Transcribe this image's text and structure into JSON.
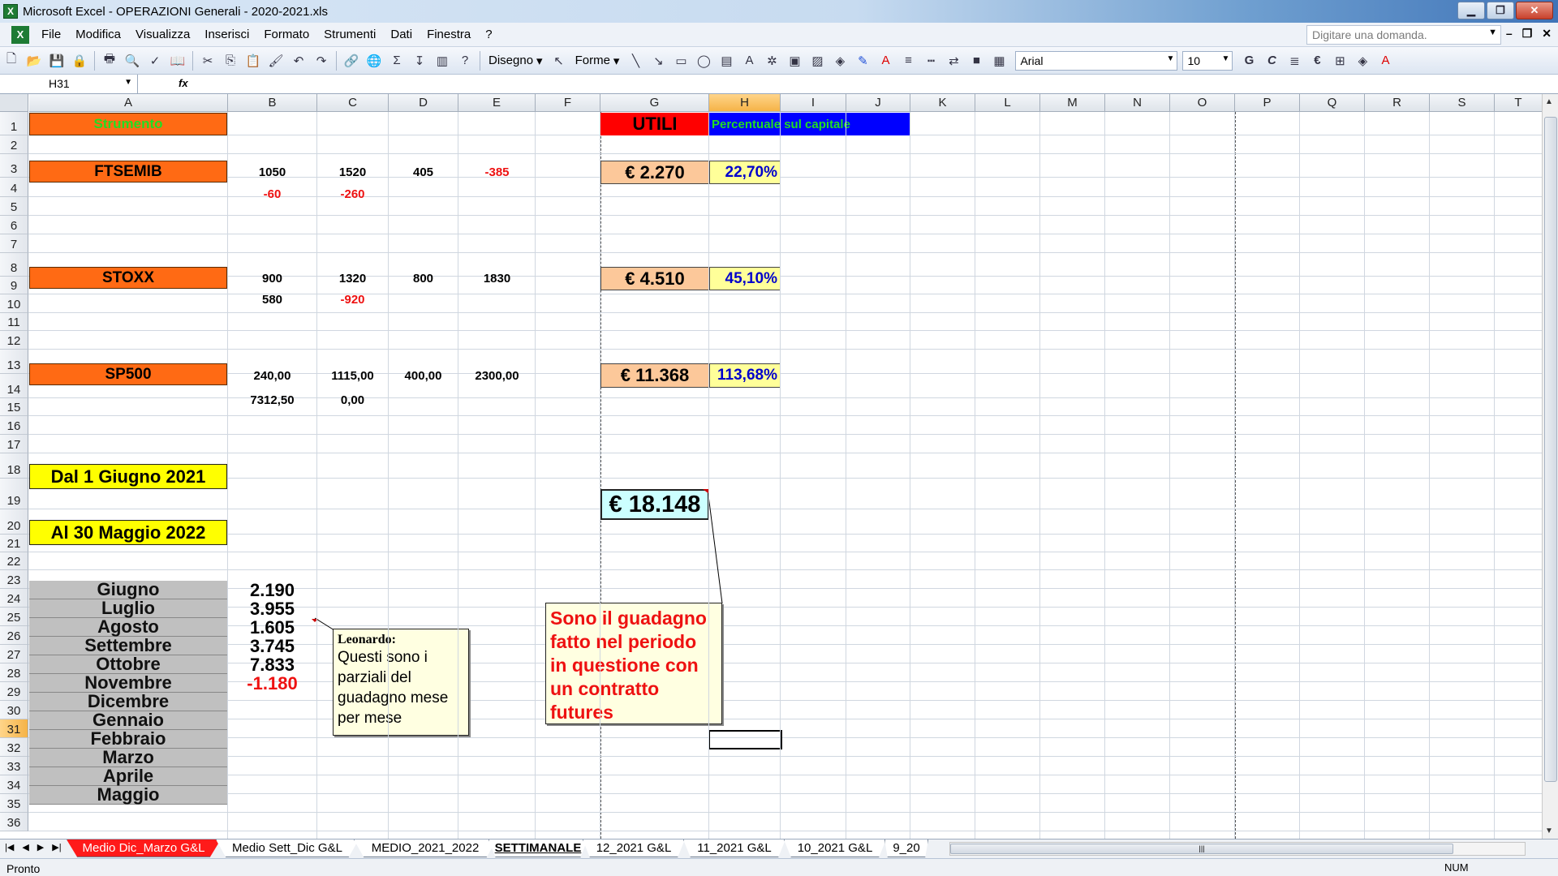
{
  "window": {
    "title": "Microsoft Excel - OPERAZIONI Generali - 2020-2021.xls"
  },
  "menu": [
    "File",
    "Modifica",
    "Visualizza",
    "Inserisci",
    "Formato",
    "Strumenti",
    "Dati",
    "Finestra",
    "?"
  ],
  "help_placeholder": "Digitare una domanda.",
  "toolbar": {
    "draw_label": "Disegno",
    "shapes_label": "Forme",
    "font": "Arial",
    "size": "10",
    "bold": "G",
    "italic": "C",
    "euro": "€"
  },
  "formula": {
    "cell_ref": "H31",
    "fx": "fx"
  },
  "columns": [
    "A",
    "B",
    "C",
    "D",
    "E",
    "F",
    "G",
    "H",
    "I",
    "J",
    "K",
    "L",
    "M",
    "N",
    "O",
    "P",
    "Q",
    "R",
    "S",
    "T"
  ],
  "rows": [
    "1",
    "2",
    "3",
    "4",
    "5",
    "6",
    "7",
    "8",
    "9",
    "10",
    "11",
    "12",
    "13",
    "14",
    "15",
    "16",
    "17",
    "18",
    "19",
    "20",
    "21",
    "22",
    "23",
    "24",
    "25",
    "26",
    "27",
    "28",
    "29",
    "30",
    "31",
    "32",
    "33",
    "34",
    "35",
    "36"
  ],
  "cells": {
    "a1": "Strumento",
    "g1": "UTILI",
    "h1": "Percentuale sul capitale",
    "a3": "FTSEMIB",
    "b3": "1050",
    "c3": "1520",
    "d3": "405",
    "e3": "-385",
    "b4": "-60",
    "c4": "-260",
    "g3": "€ 2.270",
    "h3": "22,70%",
    "a8": "STOXX",
    "b8": "900",
    "c8": "1320",
    "d8": "800",
    "e8": "1830",
    "b9": "580",
    "c9": "-920",
    "g8": "€ 4.510",
    "h8": "45,10%",
    "a13": "SP500",
    "b13": "240,00",
    "c13": "1115,00",
    "d13": "400,00",
    "e13": "2300,00",
    "b14": "7312,50",
    "c14": "0,00",
    "g13": "€ 11.368",
    "h13": "113,68%",
    "a18": "Dal 1 Giugno  2021",
    "a20": "Al 30 Maggio 2022",
    "g19": "€ 18.148"
  },
  "months": [
    "Giugno",
    "Luglio",
    "Agosto",
    "Settembre",
    "Ottobre",
    "Novembre",
    "Dicembre",
    "Gennaio",
    "Febbraio",
    "Marzo",
    "Aprile",
    "Maggio"
  ],
  "month_values": [
    "2.190",
    "3.955",
    "1.605",
    "3.745",
    "7.833",
    "-1.180"
  ],
  "comments": {
    "leonardo_author": "Leonardo:",
    "leonardo_text": "Questi sono i parziali del guadagno mese per mese",
    "futures_text": "Sono il guadagno fatto nel periodo in questione con un contratto futures"
  },
  "tabs": [
    "Medio Dic_Marzo G&L",
    "Medio Sett_Dic G&L",
    "MEDIO_2021_2022",
    "SETTIMANALE",
    "12_2021 G&L",
    "11_2021 G&L",
    "10_2021 G&L",
    "9_20"
  ],
  "status": {
    "left": "Pronto",
    "num": "NUM"
  },
  "colors": {
    "orange": "#ff6a14",
    "red": "#ff0000",
    "blue": "#0000ff",
    "yellow": "#ffff00",
    "grey": "#c0c0c0",
    "peach": "#fcc89a",
    "lightblue": "#ccffff"
  }
}
